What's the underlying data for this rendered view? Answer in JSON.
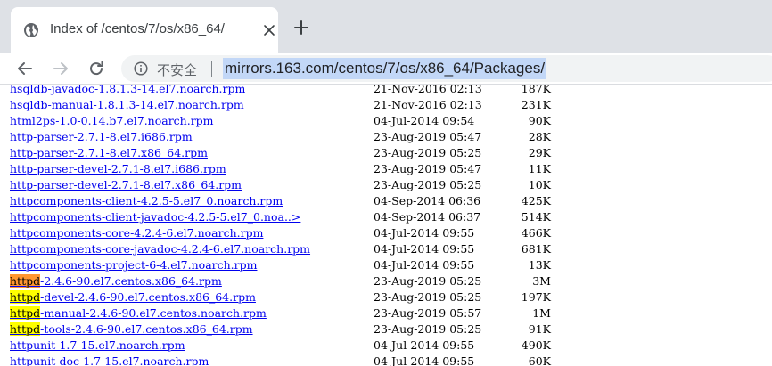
{
  "tab": {
    "title": "Index of /centos/7/os/x86_64/",
    "favicon": "globe-icon",
    "close_icon": "close-icon",
    "new_tab_icon": "plus-icon"
  },
  "toolbar": {
    "back_icon": "arrow-left-icon",
    "forward_icon": "arrow-right-icon",
    "reload_icon": "reload-icon",
    "security_icon": "info-circle-icon",
    "security_label": "不安全",
    "url": "mirrors.163.com/centos/7/os/x86_64/Packages/",
    "url_highlight_color": "#c2d7f7"
  },
  "highlight": {
    "term": "httpd",
    "current_color": "#ff9632",
    "other_color": "#ffff00"
  },
  "files": [
    {
      "prefix": "",
      "rest": "hsqldb-javadoc-1.8.1.3-14.el7.noarch.rpm",
      "date": "21-Nov-2016 02:13",
      "size": "187K"
    },
    {
      "prefix": "",
      "rest": "hsqldb-manual-1.8.1.3-14.el7.noarch.rpm",
      "date": "21-Nov-2016 02:13",
      "size": "231K"
    },
    {
      "prefix": "",
      "rest": "html2ps-1.0-0.14.b7.el7.noarch.rpm",
      "date": "04-Jul-2014 09:54",
      "size": "90K"
    },
    {
      "prefix": "",
      "rest": "http-parser-2.7.1-8.el7.i686.rpm",
      "date": "23-Aug-2019 05:47",
      "size": "28K"
    },
    {
      "prefix": "",
      "rest": "http-parser-2.7.1-8.el7.x86_64.rpm",
      "date": "23-Aug-2019 05:25",
      "size": "29K"
    },
    {
      "prefix": "",
      "rest": "http-parser-devel-2.7.1-8.el7.i686.rpm",
      "date": "23-Aug-2019 05:47",
      "size": "11K"
    },
    {
      "prefix": "",
      "rest": "http-parser-devel-2.7.1-8.el7.x86_64.rpm",
      "date": "23-Aug-2019 05:25",
      "size": "10K"
    },
    {
      "prefix": "",
      "rest": "httpcomponents-client-4.2.5-5.el7_0.noarch.rpm",
      "date": "04-Sep-2014 06:36",
      "size": "425K"
    },
    {
      "prefix": "",
      "rest": "httpcomponents-client-javadoc-4.2.5-5.el7_0.noa..>",
      "date": "04-Sep-2014 06:37",
      "size": "514K"
    },
    {
      "prefix": "",
      "rest": "httpcomponents-core-4.2.4-6.el7.noarch.rpm",
      "date": "04-Jul-2014 09:55",
      "size": "466K"
    },
    {
      "prefix": "",
      "rest": "httpcomponents-core-javadoc-4.2.4-6.el7.noarch.rpm",
      "date": "04-Jul-2014 09:55",
      "size": "681K"
    },
    {
      "prefix": "",
      "rest": "httpcomponents-project-6-4.el7.noarch.rpm",
      "date": "04-Jul-2014 09:55",
      "size": "13K"
    },
    {
      "prefix": "httpd",
      "rest": "-2.4.6-90.el7.centos.x86_64.rpm",
      "date": "23-Aug-2019 05:25",
      "size": "3M",
      "current": true
    },
    {
      "prefix": "httpd",
      "rest": "-devel-2.4.6-90.el7.centos.x86_64.rpm",
      "date": "23-Aug-2019 05:25",
      "size": "197K"
    },
    {
      "prefix": "httpd",
      "rest": "-manual-2.4.6-90.el7.centos.noarch.rpm",
      "date": "23-Aug-2019 05:57",
      "size": "1M"
    },
    {
      "prefix": "httpd",
      "rest": "-tools-2.4.6-90.el7.centos.x86_64.rpm",
      "date": "23-Aug-2019 05:25",
      "size": "91K"
    },
    {
      "prefix": "",
      "rest": "httpunit-1.7-15.el7.noarch.rpm",
      "date": "04-Jul-2014 09:55",
      "size": "490K"
    },
    {
      "prefix": "",
      "rest": "httpunit-doc-1.7-15.el7.noarch.rpm",
      "date": "04-Jul-2014 09:55",
      "size": "60K"
    }
  ]
}
